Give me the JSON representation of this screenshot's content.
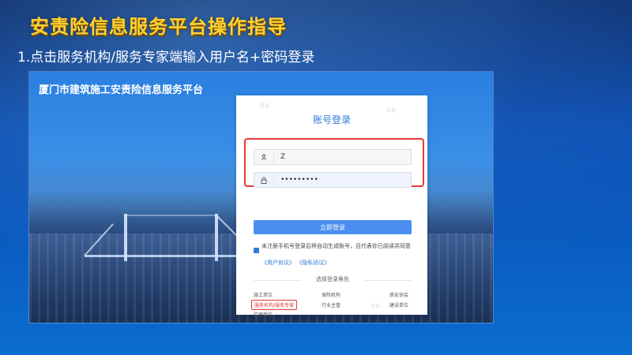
{
  "slide": {
    "title": "安责险信息服务平台操作指导",
    "step": "1.点击服务机构/服务专家端输入用户名+密码登录"
  },
  "platform": {
    "name": "厦门市建筑施工安责险信息服务平台"
  },
  "login": {
    "title": "账号登录",
    "username_value": "Z",
    "password_value": "•••••••••",
    "login_button": "立即登录",
    "agree_text": "未注册手机号登录后将自动生成账号，且代表你已阅读并同意",
    "user_agreement": "《用户协议》",
    "privacy_policy": "《隐私协议》",
    "role_section_label": "选择登录角色",
    "roles": [
      "施工单位",
      "保险机构",
      "质安协会",
      "服务机构/服务专家",
      "行业主管",
      "建设单位",
      "监理单位"
    ],
    "selected_role": "服务机构/服务专家"
  },
  "icons": {
    "user": "user-icon",
    "lock": "lock-icon",
    "checkbox": "checkbox-checked-icon"
  },
  "colors": {
    "title_yellow": "#ffd232",
    "accent_blue": "#2f7bd8",
    "button_blue": "#4a8ff0",
    "highlight_red": "#e53935"
  }
}
